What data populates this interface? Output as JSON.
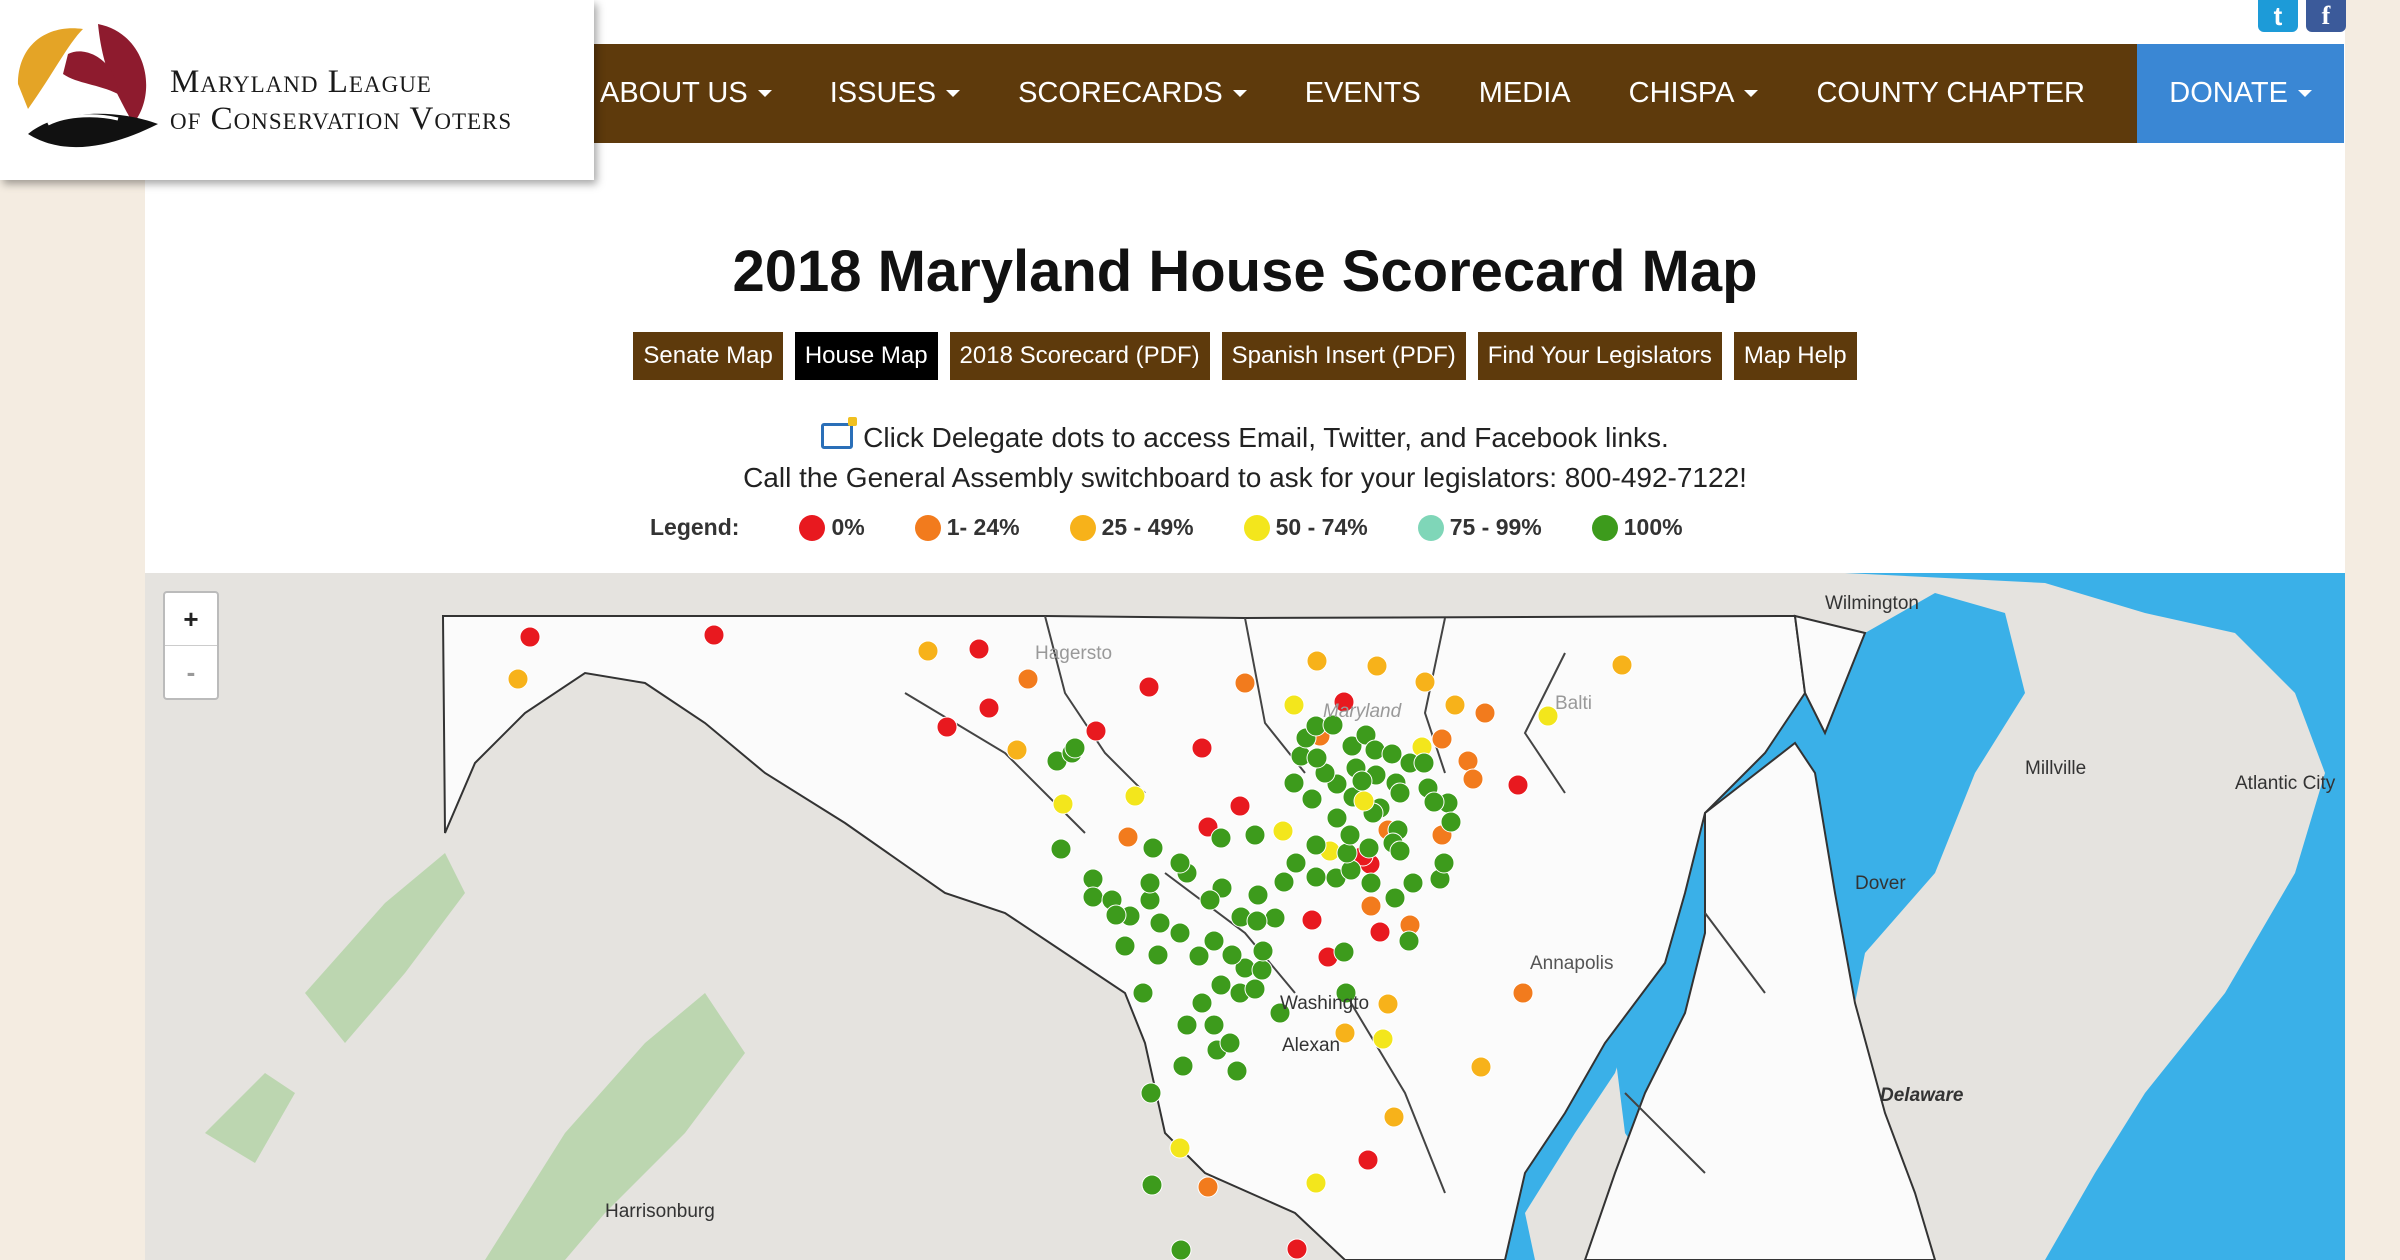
{
  "logo": {
    "line1": "Maryland League",
    "line2": "of Conservation Voters"
  },
  "social": {
    "twitter": "t",
    "facebook": "f"
  },
  "nav": {
    "items": [
      {
        "label": "ABOUT US",
        "dropdown": true
      },
      {
        "label": "ISSUES",
        "dropdown": true
      },
      {
        "label": "SCORECARDS",
        "dropdown": true
      },
      {
        "label": "EVENTS",
        "dropdown": false
      },
      {
        "label": "MEDIA",
        "dropdown": false
      },
      {
        "label": "CHISPA",
        "dropdown": true
      },
      {
        "label": "COUNTY CHAPTER",
        "dropdown": false
      }
    ],
    "donate": "DONATE"
  },
  "title": "2018 Maryland House Scorecard Map",
  "buttons": [
    "Senate Map",
    "House Map",
    "2018 Scorecard (PDF)",
    "Spanish Insert (PDF)",
    "Find Your Legislators",
    "Map Help"
  ],
  "info": {
    "line1": "Click Delegate dots to access Email, Twitter, and Facebook links.",
    "line2": "Call the General Assembly switchboard to ask for your legislators: 800-492-7122!"
  },
  "legend": {
    "label": "Legend:",
    "items": [
      {
        "label": "0%",
        "color": "#e8191f"
      },
      {
        "label": "1- 24%",
        "color": "#f27b1d"
      },
      {
        "label": "25 - 49%",
        "color": "#f7b21a"
      },
      {
        "label": "50 - 74%",
        "color": "#f3e61c"
      },
      {
        "label": "75 - 99%",
        "color": "#7fd6b8"
      },
      {
        "label": "100%",
        "color": "#3d9b1c"
      }
    ]
  },
  "map": {
    "zoom_in": "+",
    "zoom_out": "-",
    "labels": [
      "Wilmington",
      "Millville",
      "Atlantic City",
      "Dover",
      "Delaware",
      "Harrisonburg",
      "Washingto",
      "Alexan",
      "Hagersto",
      "Maryland",
      "Annapolis",
      "Balti"
    ]
  }
}
